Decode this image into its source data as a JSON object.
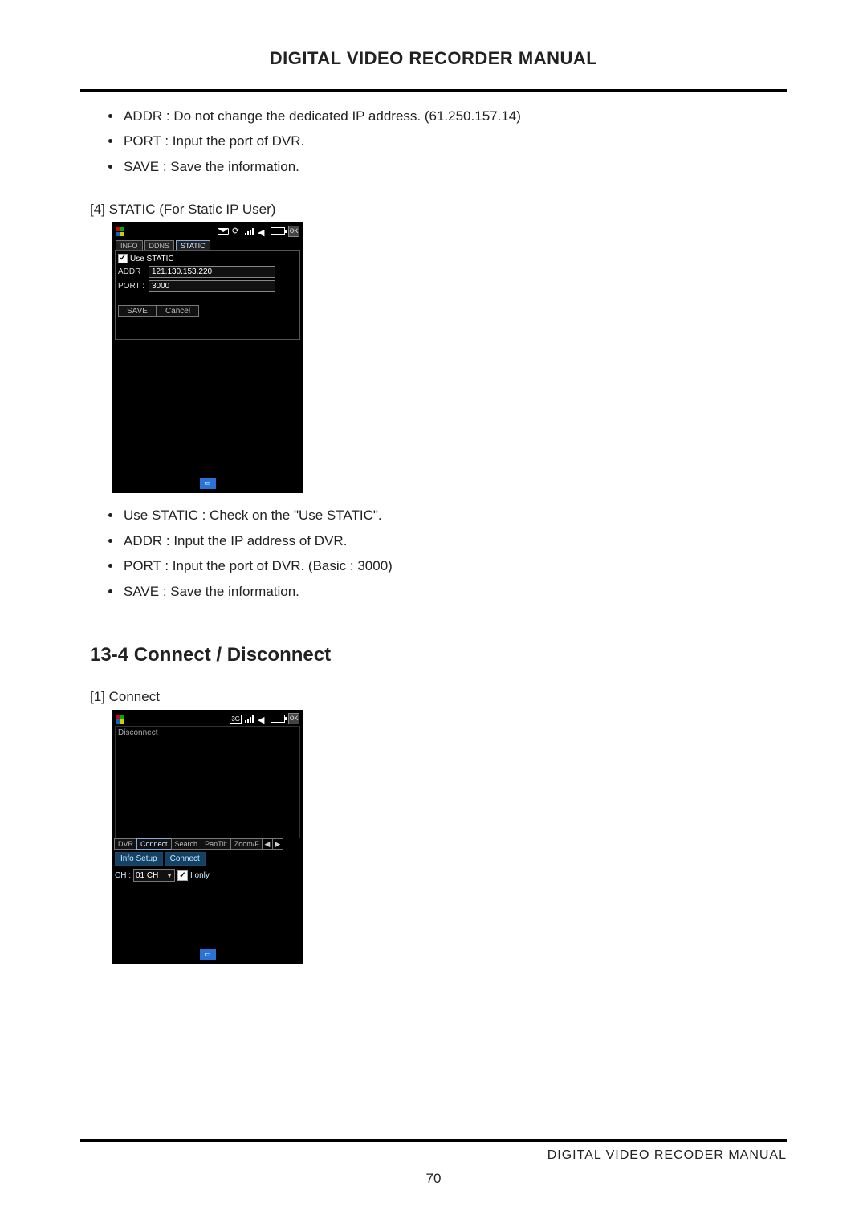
{
  "header": {
    "title": "DIGITAL VIDEO RECORDER MANUAL"
  },
  "section1": {
    "bullets": [
      "ADDR : Do not change the dedicated IP address. (61.250.157.14)",
      "PORT   : Input the port of DVR.",
      "SAVE : Save the information."
    ]
  },
  "static_caption": "[4] STATIC (For Static IP User)",
  "device1": {
    "tabs": [
      "INFO",
      "DDNS",
      "STATIC"
    ],
    "active_tab": "STATIC",
    "use_static_label": "Use STATIC",
    "addr_label": "ADDR :",
    "addr_value": "121.130.153.220",
    "port_label": "PORT :",
    "port_value": "3000",
    "save_btn": "SAVE",
    "cancel_btn": "Cancel"
  },
  "section2": {
    "bullets": [
      "Use STATIC   : Check on the \"Use STATIC\".",
      "ADDR : Input the IP address of DVR.",
      "PORT   : Input the port of DVR. (Basic : 3000)",
      "SAVE : Save the information."
    ]
  },
  "heading_connect": "13-4 Connect / Disconnect",
  "connect_caption": "[1] Connect",
  "device2": {
    "disconnect": "Disconnect",
    "tabs": [
      "DVR",
      "Connect",
      "Search",
      "PanTilt",
      "Zoom/F"
    ],
    "active_tab": "Connect",
    "arrow_left": "◀",
    "arrow_right": "▶",
    "sub_tabs": [
      "Info Setup",
      "Connect"
    ],
    "ch_label": "CH :",
    "ch_value": "01 CH",
    "i_only_label": "I only"
  },
  "footer": {
    "text": "DIGITAL VIDEO RECODER MANUAL",
    "page": "70"
  }
}
